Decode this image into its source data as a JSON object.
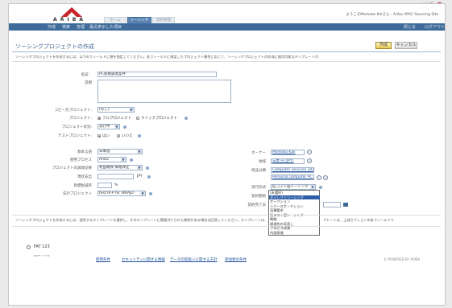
{
  "header": {
    "logo_text": "A R I B A",
    "tabs": [
      "ホーム",
      "ソーシング",
      "契約管理"
    ],
    "help_label": "ヘルプ",
    "welcome_text": "ようこそMomoko Kaiさん - Ariba APAC Sourcing Site"
  },
  "navbar": {
    "items": [
      "作成",
      "検索",
      "管理",
      "最近表示した項目"
    ],
    "right_items": [
      "閉じる",
      "ログアウト"
    ]
  },
  "page": {
    "title": "ソーシングプロジェクトの作成",
    "create_button": "作成",
    "cancel_button": "キャンセル",
    "intro_text": "ソーシングプロジェクトを作成するには、以下のフィールドに値を指定してください。各フィールドに指定したプロジェクト属性に応じて、ソーシングプロジェクトの作成に使用可能なテンプレートが、",
    "template_section_text": "ソーシングプロジェクトを作成するには、使用するテンプレートを選択し、そのテンプレートに関連付けられた質問がある場合は回答してください。テンプレートは、上部セクションの各フィールドで"
  },
  "form": {
    "name_label": "名前：",
    "name_value": "PC新規調達案件",
    "description_label": "説明",
    "copy_label": "コピー元プロジェクト:",
    "copy_value": "(なし)",
    "project_label": "プロジェクト:",
    "project_options": [
      "フルプロジェクト",
      "クイックプロジェクト"
    ],
    "status_label": "プロジェクト状況:",
    "status_value": "実行中",
    "test_label": "テストプロジェクト:",
    "test_options": [
      "はい",
      "いいえ"
    ],
    "base_language_label": "基本言語",
    "base_language_value": "日本語",
    "process_label": "使用プロセス",
    "process_value": "Ariba",
    "benefit_label": "プロジェクトの調達効果",
    "benefit_value": "利益確保 価格改定",
    "baseline_label": "現状支出",
    "baseline_currency": "JPY",
    "target_label": "目標削減率",
    "target_unit": "%",
    "predecessor_label": "先行プロジェクト",
    "predecessor_value": "test RFP for WKAJD",
    "owner_label": "オーナー",
    "owner_value": "Momoko Kaii",
    "region_label": "地域",
    "region_value": "日本 円 (JPY)",
    "commodity_label": "商品分類",
    "commodity_value_1": "Computer services 2011",
    "commodity_value_2": "Personal computer PC.app",
    "execution_label": "実行形式",
    "execution_value": "低コスト国ソーシング",
    "start_label": "契約開始",
    "due_label": "契約完了日"
  },
  "dropdown": {
    "options": [
      "(未選択)",
      "ダイレクトソーシング",
      "オークション",
      "リバースオークション",
      "見積要求",
      "低コスト国ソーシング",
      "戦略",
      "調達先の見直し",
      "プロセス改善",
      "内部調達"
    ],
    "selected_index": 1
  },
  "templates": [
    {
      "label": "FAT 123"
    },
    {
      "label": "FAT 123"
    }
  ],
  "footer": {
    "links": [
      "使用条件",
      "セキュリティに関する情報",
      "データの取扱いに関する方針",
      "参加者の条件"
    ],
    "powered_by": "© POWERED BY ARIBA"
  },
  "browser": {
    "zoom_label": "A&#8212; 7 ▾"
  }
}
